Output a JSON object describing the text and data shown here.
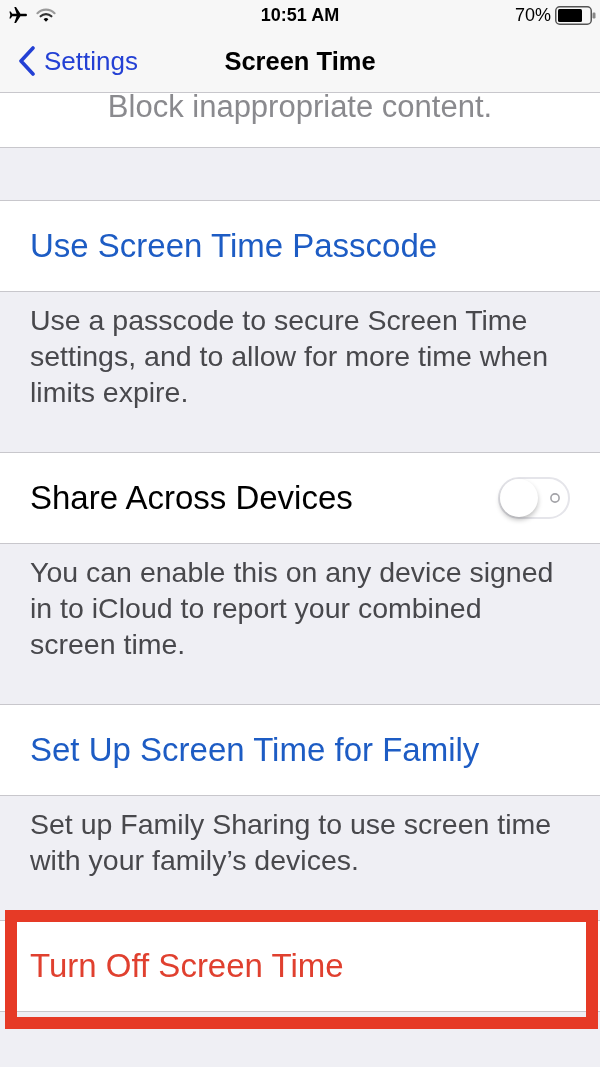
{
  "status_bar": {
    "time": "10:51 AM",
    "battery_percent": "70%"
  },
  "nav_bar": {
    "back_label": "Settings",
    "title": "Screen Time"
  },
  "sections": [
    {
      "cell": {
        "kind": "text",
        "label": "Block inappropriate content.",
        "highlighted": false
      }
    },
    {
      "cell": {
        "kind": "action",
        "label": "Use Screen Time Passcode",
        "highlighted": false
      },
      "footer": "Use a passcode to secure Screen Time settings, and to allow for more time when limits expire."
    },
    {
      "cell": {
        "kind": "toggle",
        "label": "Share Across Devices",
        "on": false,
        "highlighted": false
      },
      "footer": "You can enable this on any device signed in to iCloud to report your combined screen time."
    },
    {
      "cell": {
        "kind": "action",
        "label": "Set Up Screen Time for Family",
        "highlighted": false
      },
      "footer": "Set up Family Sharing to use screen time with your family’s devices."
    },
    {
      "cell": {
        "kind": "destructive",
        "label": "Turn Off Screen Time",
        "highlighted": true
      }
    }
  ]
}
